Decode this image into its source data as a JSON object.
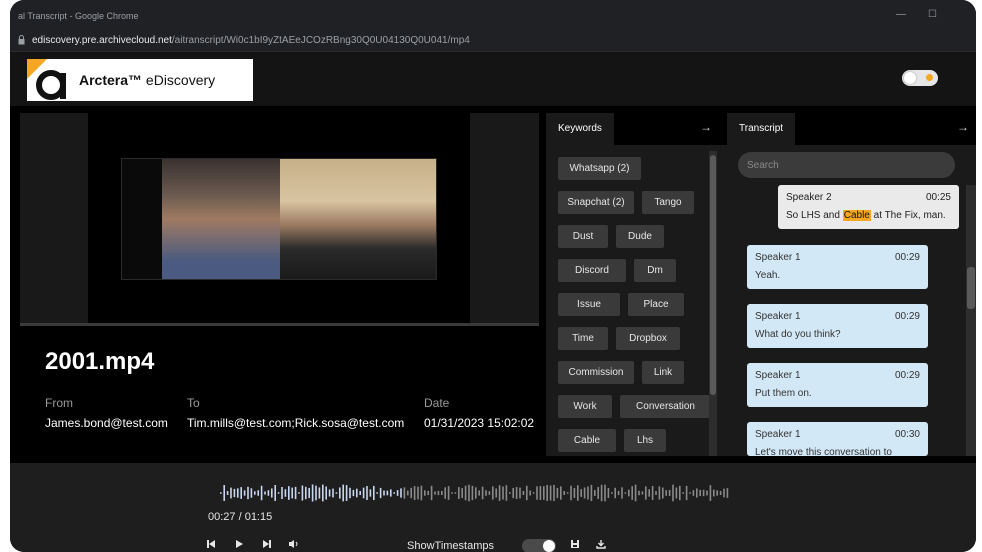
{
  "browser": {
    "tab_title": "al Transcript - Google Chrome",
    "url_host": "ediscovery.pre.archivecloud.net",
    "url_path": "/aitranscript/Wi0c1bI9yZtAEeJCOzRBng30Q0U04130Q0U041/mp4"
  },
  "header": {
    "brand_bold": "Arctera™",
    "brand_rest": " eDiscovery",
    "logo_letter": "a"
  },
  "file": {
    "name": "2001.mp4",
    "from_label": "From",
    "from_value": "James.bond@test.com",
    "to_label": "To",
    "to_value": "Tim.mills@test.com;Rick.sosa@test.com",
    "date_label": "Date",
    "date_value": "01/31/2023 15:02:02"
  },
  "keywords_panel": {
    "title": "Keywords",
    "arrow": "→",
    "items": [
      "Whatsapp (2)",
      "Snapchat (2)",
      "Tango",
      "Dust",
      "Dude",
      "Discord",
      "Dm",
      "Issue",
      "Place",
      "Time",
      "Dropbox",
      "Commission",
      "Link",
      "Work",
      "Conversation",
      "Cable",
      "Lhs"
    ]
  },
  "transcript_panel": {
    "title": "Transcript",
    "arrow": "→",
    "search_placeholder": "Search",
    "messages": [
      {
        "speaker": "Speaker 2",
        "time": "00:25",
        "text_before": "So LHS and ",
        "highlight": "Cable",
        "text_after": " at The Fix, man."
      },
      {
        "speaker": "Speaker 1",
        "time": "00:29",
        "text": "Yeah."
      },
      {
        "speaker": "Speaker 1",
        "time": "00:29",
        "text": "What do you think?"
      },
      {
        "speaker": "Speaker 1",
        "time": "00:29",
        "text": "Put them on."
      },
      {
        "speaker": "Speaker 1",
        "time": "00:30",
        "text": "Let's move this conversation to"
      }
    ]
  },
  "player": {
    "time": "00:27 / 01:15",
    "progress_fraction": 0.36,
    "prev_icon": "skip-back-icon",
    "play_icon": "play-icon",
    "next_icon": "skip-forward-icon",
    "volume_icon": "volume-icon",
    "show_timestamps_label": "ShowTimestamps",
    "show_timestamps_on": true,
    "save_icon": "save-icon",
    "download_icon": "download-icon"
  },
  "colors": {
    "highlight": "#f5a623",
    "bubble_other": "#d3e8f6",
    "bubble_me": "#eaeaea",
    "keyword_chip": "#3a3a3a"
  }
}
